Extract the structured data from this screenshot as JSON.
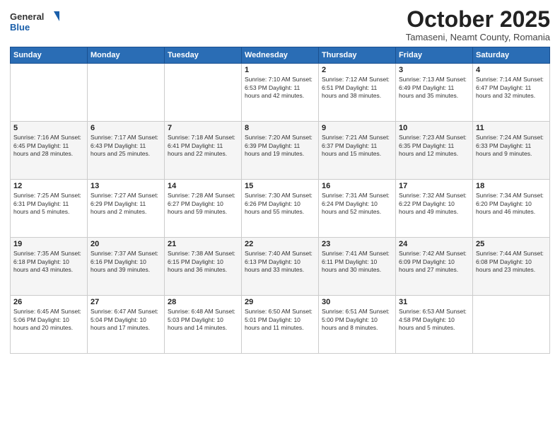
{
  "header": {
    "logo_general": "General",
    "logo_blue": "Blue",
    "title": "October 2025",
    "location": "Tamaseni, Neamt County, Romania"
  },
  "calendar": {
    "days_of_week": [
      "Sunday",
      "Monday",
      "Tuesday",
      "Wednesday",
      "Thursday",
      "Friday",
      "Saturday"
    ],
    "weeks": [
      [
        {
          "day": "",
          "info": ""
        },
        {
          "day": "",
          "info": ""
        },
        {
          "day": "",
          "info": ""
        },
        {
          "day": "1",
          "info": "Sunrise: 7:10 AM\nSunset: 6:53 PM\nDaylight: 11 hours and 42 minutes."
        },
        {
          "day": "2",
          "info": "Sunrise: 7:12 AM\nSunset: 6:51 PM\nDaylight: 11 hours and 38 minutes."
        },
        {
          "day": "3",
          "info": "Sunrise: 7:13 AM\nSunset: 6:49 PM\nDaylight: 11 hours and 35 minutes."
        },
        {
          "day": "4",
          "info": "Sunrise: 7:14 AM\nSunset: 6:47 PM\nDaylight: 11 hours and 32 minutes."
        }
      ],
      [
        {
          "day": "5",
          "info": "Sunrise: 7:16 AM\nSunset: 6:45 PM\nDaylight: 11 hours and 28 minutes."
        },
        {
          "day": "6",
          "info": "Sunrise: 7:17 AM\nSunset: 6:43 PM\nDaylight: 11 hours and 25 minutes."
        },
        {
          "day": "7",
          "info": "Sunrise: 7:18 AM\nSunset: 6:41 PM\nDaylight: 11 hours and 22 minutes."
        },
        {
          "day": "8",
          "info": "Sunrise: 7:20 AM\nSunset: 6:39 PM\nDaylight: 11 hours and 19 minutes."
        },
        {
          "day": "9",
          "info": "Sunrise: 7:21 AM\nSunset: 6:37 PM\nDaylight: 11 hours and 15 minutes."
        },
        {
          "day": "10",
          "info": "Sunrise: 7:23 AM\nSunset: 6:35 PM\nDaylight: 11 hours and 12 minutes."
        },
        {
          "day": "11",
          "info": "Sunrise: 7:24 AM\nSunset: 6:33 PM\nDaylight: 11 hours and 9 minutes."
        }
      ],
      [
        {
          "day": "12",
          "info": "Sunrise: 7:25 AM\nSunset: 6:31 PM\nDaylight: 11 hours and 5 minutes."
        },
        {
          "day": "13",
          "info": "Sunrise: 7:27 AM\nSunset: 6:29 PM\nDaylight: 11 hours and 2 minutes."
        },
        {
          "day": "14",
          "info": "Sunrise: 7:28 AM\nSunset: 6:27 PM\nDaylight: 10 hours and 59 minutes."
        },
        {
          "day": "15",
          "info": "Sunrise: 7:30 AM\nSunset: 6:26 PM\nDaylight: 10 hours and 55 minutes."
        },
        {
          "day": "16",
          "info": "Sunrise: 7:31 AM\nSunset: 6:24 PM\nDaylight: 10 hours and 52 minutes."
        },
        {
          "day": "17",
          "info": "Sunrise: 7:32 AM\nSunset: 6:22 PM\nDaylight: 10 hours and 49 minutes."
        },
        {
          "day": "18",
          "info": "Sunrise: 7:34 AM\nSunset: 6:20 PM\nDaylight: 10 hours and 46 minutes."
        }
      ],
      [
        {
          "day": "19",
          "info": "Sunrise: 7:35 AM\nSunset: 6:18 PM\nDaylight: 10 hours and 43 minutes."
        },
        {
          "day": "20",
          "info": "Sunrise: 7:37 AM\nSunset: 6:16 PM\nDaylight: 10 hours and 39 minutes."
        },
        {
          "day": "21",
          "info": "Sunrise: 7:38 AM\nSunset: 6:15 PM\nDaylight: 10 hours and 36 minutes."
        },
        {
          "day": "22",
          "info": "Sunrise: 7:40 AM\nSunset: 6:13 PM\nDaylight: 10 hours and 33 minutes."
        },
        {
          "day": "23",
          "info": "Sunrise: 7:41 AM\nSunset: 6:11 PM\nDaylight: 10 hours and 30 minutes."
        },
        {
          "day": "24",
          "info": "Sunrise: 7:42 AM\nSunset: 6:09 PM\nDaylight: 10 hours and 27 minutes."
        },
        {
          "day": "25",
          "info": "Sunrise: 7:44 AM\nSunset: 6:08 PM\nDaylight: 10 hours and 23 minutes."
        }
      ],
      [
        {
          "day": "26",
          "info": "Sunrise: 6:45 AM\nSunset: 5:06 PM\nDaylight: 10 hours and 20 minutes."
        },
        {
          "day": "27",
          "info": "Sunrise: 6:47 AM\nSunset: 5:04 PM\nDaylight: 10 hours and 17 minutes."
        },
        {
          "day": "28",
          "info": "Sunrise: 6:48 AM\nSunset: 5:03 PM\nDaylight: 10 hours and 14 minutes."
        },
        {
          "day": "29",
          "info": "Sunrise: 6:50 AM\nSunset: 5:01 PM\nDaylight: 10 hours and 11 minutes."
        },
        {
          "day": "30",
          "info": "Sunrise: 6:51 AM\nSunset: 5:00 PM\nDaylight: 10 hours and 8 minutes."
        },
        {
          "day": "31",
          "info": "Sunrise: 6:53 AM\nSunset: 4:58 PM\nDaylight: 10 hours and 5 minutes."
        },
        {
          "day": "",
          "info": ""
        }
      ]
    ]
  }
}
